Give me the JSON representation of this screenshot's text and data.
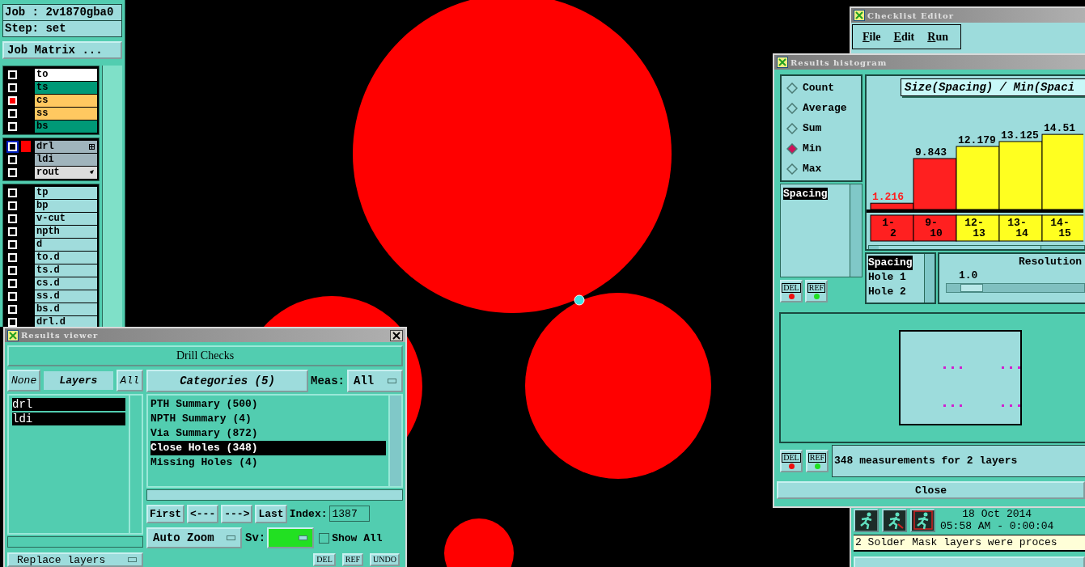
{
  "job_panel": {
    "job": "Job : 2v1870gba0",
    "step": "Step: set",
    "matrix_button": "Job Matrix ...",
    "layer_groups": [
      [
        {
          "name": "to",
          "color": "#ffffff",
          "checked": false,
          "work": false,
          "kind": "plain"
        },
        {
          "name": "ts",
          "color": "#009977",
          "checked": false,
          "work": false,
          "kind": "plain"
        },
        {
          "name": "cs",
          "color": "#ffc860",
          "checked": true,
          "work": false,
          "kind": "plain"
        },
        {
          "name": "ss",
          "color": "#ffc860",
          "checked": false,
          "work": false,
          "kind": "plain"
        },
        {
          "name": "bs",
          "color": "#009977",
          "checked": false,
          "work": false,
          "kind": "plain"
        }
      ],
      [
        {
          "name": "drl",
          "color": "#a0b4bc",
          "checked": false,
          "work": true,
          "kind": "grid"
        },
        {
          "name": "ldi",
          "color": "#a0b4bc",
          "checked": false,
          "work": false,
          "kind": "plain"
        },
        {
          "name": "rout",
          "color": "#dcdcdc",
          "checked": false,
          "work": false,
          "kind": "pointer"
        }
      ],
      [
        {
          "name": "tp",
          "color": "#a0dcdc",
          "checked": false,
          "work": false,
          "kind": "plain"
        },
        {
          "name": "bp",
          "color": "#a0dcdc",
          "checked": false,
          "work": false,
          "kind": "plain"
        },
        {
          "name": "v-cut",
          "color": "#a0dcdc",
          "checked": false,
          "work": false,
          "kind": "plain"
        },
        {
          "name": "npth",
          "color": "#a0dcdc",
          "checked": false,
          "work": false,
          "kind": "plain"
        },
        {
          "name": "d",
          "color": "#a0dcdc",
          "checked": false,
          "work": false,
          "kind": "plain"
        },
        {
          "name": "to.d",
          "color": "#a0dcdc",
          "checked": false,
          "work": false,
          "kind": "plain"
        },
        {
          "name": "ts.d",
          "color": "#a0dcdc",
          "checked": false,
          "work": false,
          "kind": "plain"
        },
        {
          "name": "cs.d",
          "color": "#a0dcdc",
          "checked": false,
          "work": false,
          "kind": "plain"
        },
        {
          "name": "ss.d",
          "color": "#a0dcdc",
          "checked": false,
          "work": false,
          "kind": "plain"
        },
        {
          "name": "bs.d",
          "color": "#a0dcdc",
          "checked": false,
          "work": false,
          "kind": "plain"
        },
        {
          "name": "drl.d",
          "color": "#a0dcdc",
          "checked": false,
          "work": false,
          "kind": "plain"
        }
      ]
    ]
  },
  "results_viewer": {
    "title": "Results viewer",
    "header": "Drill Checks",
    "layer_buttons": [
      {
        "label": "None",
        "selected": false
      },
      {
        "label": "Layers",
        "selected": true
      },
      {
        "label": "All",
        "selected": false
      }
    ],
    "layers": [
      {
        "name": "drl",
        "selected": true
      },
      {
        "name": "ldi",
        "selected": true
      }
    ],
    "categories_header": "Categories (5)",
    "meas_label": "Meas:",
    "meas_value": "All",
    "categories": [
      {
        "label": "PTH Summary (500)",
        "selected": false
      },
      {
        "label": "NPTH Summary (4)",
        "selected": false
      },
      {
        "label": "Via Summary (872)",
        "selected": false
      },
      {
        "label": "Close Holes (348)",
        "selected": true
      },
      {
        "label": "Missing Holes (4)",
        "selected": false
      }
    ],
    "nav_buttons": [
      "First",
      "<---",
      "--->",
      "Last"
    ],
    "index_label": "Index:",
    "index_value": "1387",
    "zoom_mode": "Auto Zoom",
    "sv_label": "Sv:",
    "show_all": {
      "label": "Show All",
      "checked": false
    },
    "replace_button": "Replace layers",
    "action_buttons": [
      "DEL",
      "REF",
      "UNDO"
    ]
  },
  "checklist_editor": {
    "title": "Checklist Editor",
    "menu": [
      "File",
      "Edit",
      "Run"
    ],
    "date": "18 Oct 2014",
    "time": "05:58 AM - 0:00:04",
    "message": "2 Solder Mask layers were proces"
  },
  "histogram": {
    "title": "Results histogram",
    "modes": [
      {
        "label": "Count",
        "selected": false
      },
      {
        "label": "Average",
        "selected": false
      },
      {
        "label": "Sum",
        "selected": false
      },
      {
        "label": "Min",
        "selected": true
      },
      {
        "label": "Max",
        "selected": false
      }
    ],
    "measures": [
      {
        "label": "Spacing",
        "selected": true
      }
    ],
    "buttons": [
      "DEL",
      "REF"
    ],
    "chart_data": {
      "type": "bar",
      "title": "Size(Spacing) / Min(Spaci",
      "categories": [
        "1-2",
        "9-10",
        "12-13",
        "13-14",
        "14-15"
      ],
      "data_labels": true,
      "series": [
        {
          "color": "#ff2020",
          "values": [
            1.216,
            9.843,
            null,
            null,
            null
          ]
        },
        {
          "color": "#ffff20",
          "values": [
            null,
            null,
            12.179,
            13.125,
            14.51
          ]
        }
      ]
    },
    "fields": [
      {
        "label": "Spacing",
        "selected": true
      },
      {
        "label": "Hole 1",
        "selected": false
      },
      {
        "label": "Hole 2",
        "selected": false
      }
    ],
    "resolution": {
      "label": "Resolution",
      "value": "1.0",
      "level": 0.1
    },
    "status_buttons": [
      "DEL",
      "REF"
    ],
    "status": "348 measurements for 2 layers",
    "close_button": "Close"
  }
}
